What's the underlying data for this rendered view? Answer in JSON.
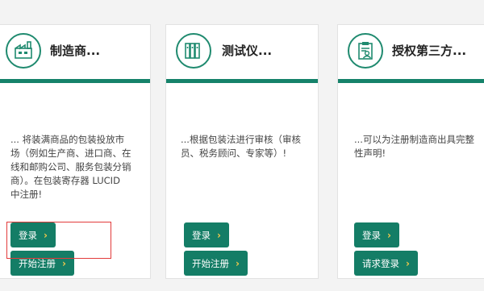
{
  "cards": [
    {
      "title": "制造商...",
      "icon": "factory-icon",
      "description": "... 将装满商品的包装投放市场（例如生产商、进口商、在线和邮购公司、服务包装分销商）。在包装寄存器 LUCID 中注册!",
      "buttons": [
        {
          "label": "登录"
        },
        {
          "label": "开始注册"
        }
      ]
    },
    {
      "title": "测试仪...",
      "icon": "binders-icon",
      "description": "...根据包装法进行审核（审核员、税务顾问、专家等）!",
      "buttons": [
        {
          "label": "登录"
        },
        {
          "label": "开始注册"
        }
      ]
    },
    {
      "title": "授权第三方...",
      "icon": "clipboard-user-icon",
      "description": "...可以为注册制造商出具完整性声明!",
      "buttons": [
        {
          "label": "登录"
        },
        {
          "label": "请求登录"
        }
      ]
    }
  ],
  "colors": {
    "accent": "#147d66",
    "chevron": "#f2c94c",
    "highlight": "#e23b3b"
  }
}
